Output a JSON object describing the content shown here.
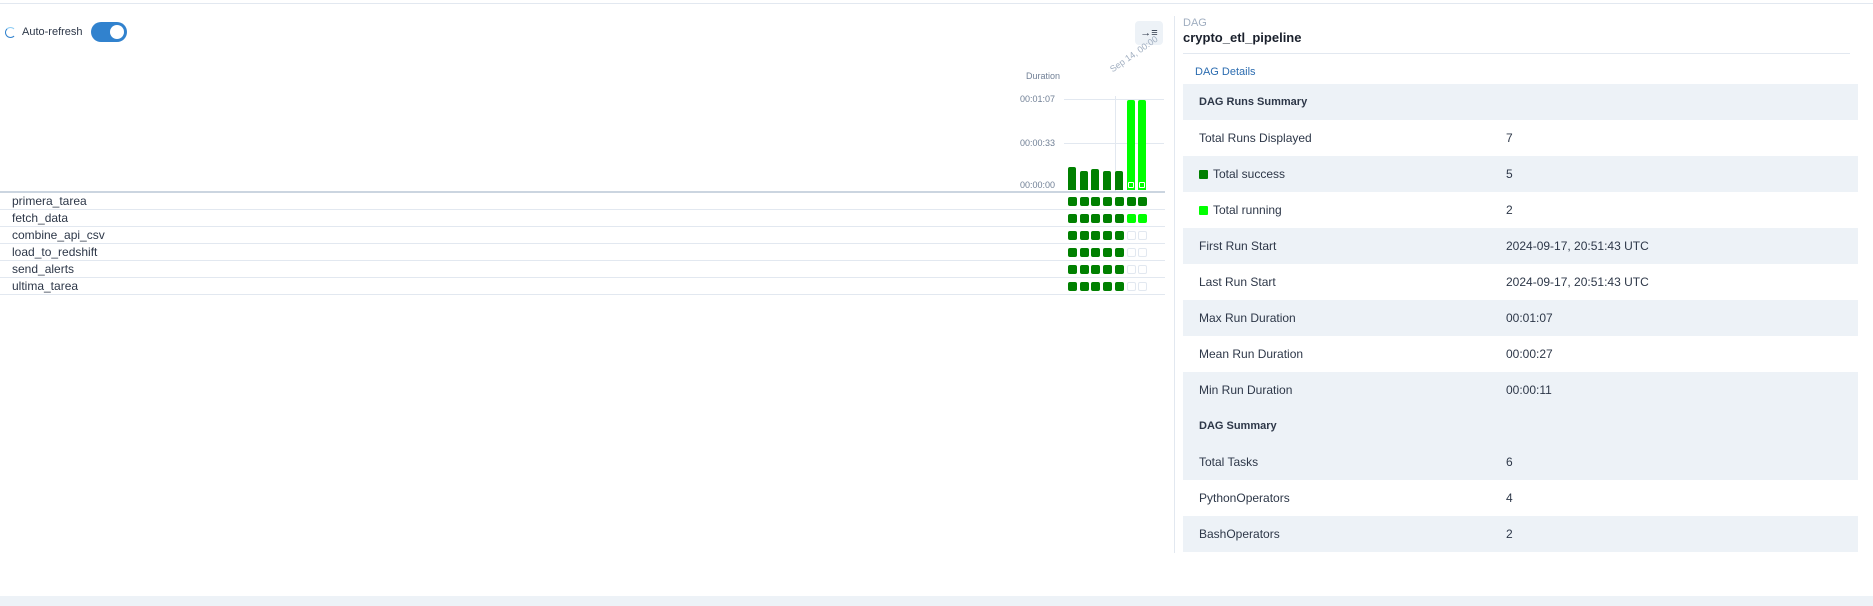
{
  "header": {
    "auto_refresh_label": "Auto-refresh",
    "auto_refresh_on": true
  },
  "grid": {
    "duration_label": "Duration",
    "y_ticks": [
      "00:01:07",
      "00:00:33",
      "00:00:00"
    ],
    "date_label": "Sep 14, 00:00",
    "run_durations_seconds": [
      17,
      14,
      16,
      14,
      14,
      67,
      67
    ],
    "run_states": [
      "success",
      "success",
      "success",
      "success",
      "success",
      "running",
      "running"
    ],
    "tasks": [
      {
        "name": "primera_tarea",
        "states": [
          "success",
          "success",
          "success",
          "success",
          "success",
          "success",
          "success"
        ]
      },
      {
        "name": "fetch_data",
        "states": [
          "success",
          "success",
          "success",
          "success",
          "success",
          "running",
          "running"
        ]
      },
      {
        "name": "combine_api_csv",
        "states": [
          "success",
          "success",
          "success",
          "success",
          "success",
          "none",
          "none"
        ]
      },
      {
        "name": "load_to_redshift",
        "states": [
          "success",
          "success",
          "success",
          "success",
          "success",
          "none",
          "none"
        ]
      },
      {
        "name": "send_alerts",
        "states": [
          "success",
          "success",
          "success",
          "success",
          "success",
          "none",
          "none"
        ]
      },
      {
        "name": "ultima_tarea",
        "states": [
          "success",
          "success",
          "success",
          "success",
          "success",
          "none",
          "none"
        ]
      }
    ]
  },
  "details": {
    "breadcrumb": "DAG",
    "dag_id": "crypto_etl_pipeline",
    "tab": "DAG Details",
    "runs_summary_header": "DAG Runs Summary",
    "rows": [
      {
        "label": "Total Runs Displayed",
        "value": "7"
      },
      {
        "label": "Total success",
        "value": "5",
        "status": "success"
      },
      {
        "label": "Total running",
        "value": "2",
        "status": "running"
      },
      {
        "label": "First Run Start",
        "value": "2024-09-17, 20:51:43 UTC"
      },
      {
        "label": "Last Run Start",
        "value": "2024-09-17, 20:51:43 UTC"
      },
      {
        "label": "Max Run Duration",
        "value": "00:01:07"
      },
      {
        "label": "Mean Run Duration",
        "value": "00:00:27"
      },
      {
        "label": "Min Run Duration",
        "value": "00:00:11"
      }
    ],
    "dag_summary_header": "DAG Summary",
    "summary_rows": [
      {
        "label": "Total Tasks",
        "value": "6"
      },
      {
        "label": "PythonOperators",
        "value": "4"
      },
      {
        "label": "BashOperators",
        "value": "2"
      }
    ]
  },
  "colors": {
    "success": "#008000",
    "running": "#00ff00",
    "none_border": "#e2e8f0",
    "accent": "#3182ce"
  }
}
